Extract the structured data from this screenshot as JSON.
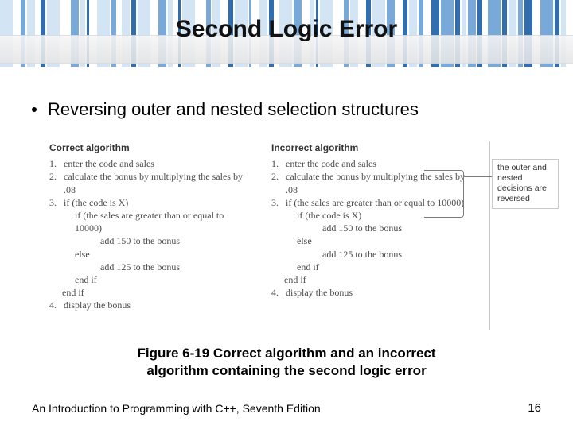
{
  "title": "Second Logic Error",
  "bullet": "Reversing outer and nested selection structures",
  "correct": {
    "heading": "Correct algorithm",
    "s1": "enter the code and sales",
    "s2": "calculate the bonus by multiplying the sales by .08",
    "s3": "if (the code is X)",
    "s3a": "if (the sales are greater than or equal to 10000)",
    "s3b": "add 150 to the bonus",
    "s3c": "else",
    "s3d": "add 125 to the bonus",
    "s3e": "end if",
    "s3f": "end if",
    "s4": "display the bonus"
  },
  "incorrect": {
    "heading": "Incorrect algorithm",
    "s1": "enter the code and sales",
    "s2": "calculate the bonus by multiplying the sales by .08",
    "s3": "if (the sales are greater than or equal to 10000)",
    "s3a": "if (the code is X)",
    "s3b": "add 150 to the bonus",
    "s3c": "else",
    "s3d": "add 125 to the bonus",
    "s3e": "end if",
    "s3f": "end if",
    "s4": "display the bonus"
  },
  "callout": "the outer and nested decisions are reversed",
  "caption_line1": "Figure 6-19 Correct algorithm and an incorrect",
  "caption_line2": "algorithm containing the second logic error",
  "footer_left": "An Introduction to Programming with C++, Seventh Edition",
  "footer_right": "16",
  "numbers": {
    "n1": "1.",
    "n2": "2.",
    "n3": "3.",
    "n4": "4."
  }
}
